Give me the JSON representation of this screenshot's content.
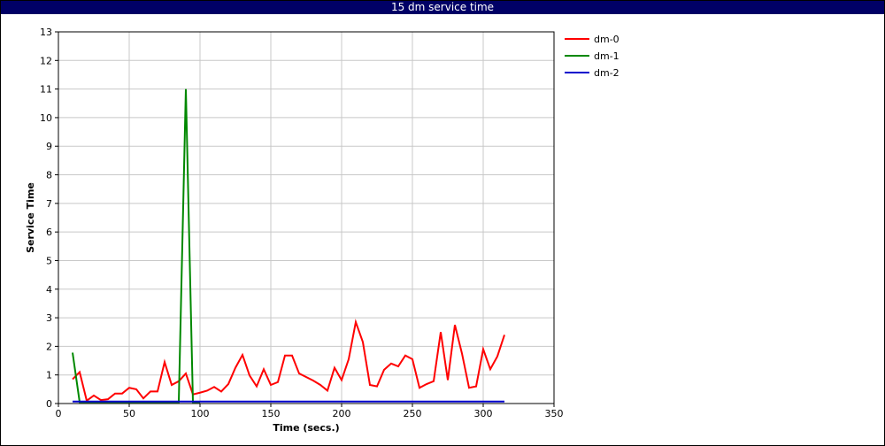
{
  "window": {
    "title": "15 dm service time"
  },
  "chart_data": {
    "type": "line",
    "title": "15 dm service time",
    "xlabel": "Time (secs.)",
    "ylabel": "Service Time",
    "xlim": [
      0,
      350
    ],
    "ylim": [
      0,
      13
    ],
    "xticks": [
      0,
      50,
      100,
      150,
      200,
      250,
      300,
      350
    ],
    "yticks": [
      0,
      1,
      2,
      3,
      4,
      5,
      6,
      7,
      8,
      9,
      10,
      11,
      12,
      13
    ],
    "grid": true,
    "legend_position": "right",
    "series": [
      {
        "name": "dm-0",
        "color": "#ff0000",
        "points": [
          [
            10,
            0.85
          ],
          [
            15,
            1.1
          ],
          [
            20,
            0.1
          ],
          [
            25,
            0.28
          ],
          [
            30,
            0.12
          ],
          [
            35,
            0.15
          ],
          [
            40,
            0.35
          ],
          [
            45,
            0.35
          ],
          [
            50,
            0.55
          ],
          [
            55,
            0.5
          ],
          [
            60,
            0.18
          ],
          [
            65,
            0.42
          ],
          [
            70,
            0.42
          ],
          [
            75,
            1.45
          ],
          [
            80,
            0.65
          ],
          [
            85,
            0.78
          ],
          [
            90,
            1.05
          ],
          [
            95,
            0.32
          ],
          [
            100,
            0.38
          ],
          [
            105,
            0.45
          ],
          [
            110,
            0.58
          ],
          [
            115,
            0.42
          ],
          [
            120,
            0.68
          ],
          [
            125,
            1.25
          ],
          [
            130,
            1.7
          ],
          [
            135,
            0.98
          ],
          [
            140,
            0.6
          ],
          [
            145,
            1.2
          ],
          [
            150,
            0.65
          ],
          [
            155,
            0.75
          ],
          [
            160,
            1.68
          ],
          [
            165,
            1.68
          ],
          [
            170,
            1.05
          ],
          [
            180,
            0.8
          ],
          [
            185,
            0.65
          ],
          [
            190,
            0.45
          ],
          [
            195,
            1.25
          ],
          [
            200,
            0.82
          ],
          [
            205,
            1.55
          ],
          [
            210,
            2.85
          ],
          [
            215,
            2.15
          ],
          [
            220,
            0.65
          ],
          [
            225,
            0.6
          ],
          [
            230,
            1.18
          ],
          [
            235,
            1.4
          ],
          [
            240,
            1.3
          ],
          [
            245,
            1.68
          ],
          [
            250,
            1.55
          ],
          [
            255,
            0.55
          ],
          [
            260,
            0.68
          ],
          [
            265,
            0.78
          ],
          [
            270,
            2.5
          ],
          [
            275,
            0.82
          ],
          [
            280,
            2.75
          ],
          [
            285,
            1.75
          ],
          [
            290,
            0.55
          ],
          [
            295,
            0.6
          ],
          [
            300,
            1.9
          ],
          [
            305,
            1.2
          ],
          [
            310,
            1.65
          ],
          [
            315,
            2.4
          ]
        ]
      },
      {
        "name": "dm-1",
        "color": "#008800",
        "points": [
          [
            10,
            1.78
          ],
          [
            15,
            0.05
          ],
          [
            20,
            0.05
          ],
          [
            25,
            0.05
          ],
          [
            30,
            0.05
          ],
          [
            35,
            0.05
          ],
          [
            40,
            0.05
          ],
          [
            45,
            0.05
          ],
          [
            50,
            0.05
          ],
          [
            55,
            0.05
          ],
          [
            60,
            0.05
          ],
          [
            65,
            0.05
          ],
          [
            70,
            0.05
          ],
          [
            75,
            0.05
          ],
          [
            80,
            0.05
          ],
          [
            85,
            0.05
          ],
          [
            90,
            11.0
          ],
          [
            95,
            0.05
          ],
          [
            100,
            0.05
          ]
        ]
      },
      {
        "name": "dm-2",
        "color": "#0000cc",
        "points": [
          [
            10,
            0.07
          ],
          [
            50,
            0.07
          ],
          [
            100,
            0.07
          ],
          [
            150,
            0.07
          ],
          [
            200,
            0.07
          ],
          [
            250,
            0.07
          ],
          [
            300,
            0.07
          ],
          [
            315,
            0.07
          ]
        ]
      }
    ]
  }
}
